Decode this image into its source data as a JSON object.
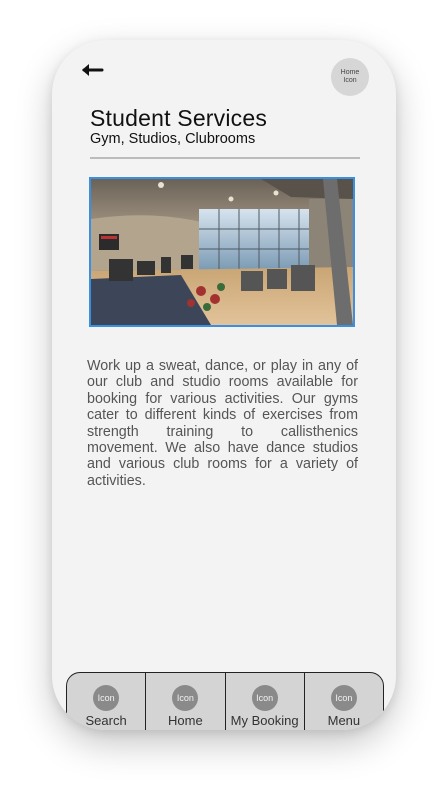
{
  "header": {
    "back_icon": "arrow-left-icon",
    "home_icon_text": "Home\nIcon"
  },
  "page": {
    "title": "Student Services",
    "subtitle": "Gym, Studios, Clubrooms",
    "description": "Work up a sweat, dance, or play in any of our club and studio rooms available for booking for various activities. Our gyms cater to different kinds of exercises from strength training to callisthenics movement. We also have dance studios and various club rooms for a variety of activities."
  },
  "hero_image": {
    "subject": "gym-interior-photo",
    "border_color": "#3b8fe0"
  },
  "bottom_nav": {
    "items": [
      {
        "icon_text": "Icon",
        "label": "Search"
      },
      {
        "icon_text": "Icon",
        "label": "Home"
      },
      {
        "icon_text": "Icon",
        "label": "My Booking"
      },
      {
        "icon_text": "Icon",
        "label": "Menu"
      }
    ]
  },
  "colors": {
    "screen_bg": "#f3f3f3",
    "nav_bg": "#d4d4d4",
    "icon_circle": "#8a8a8a",
    "accent": "#3b8fe0"
  }
}
